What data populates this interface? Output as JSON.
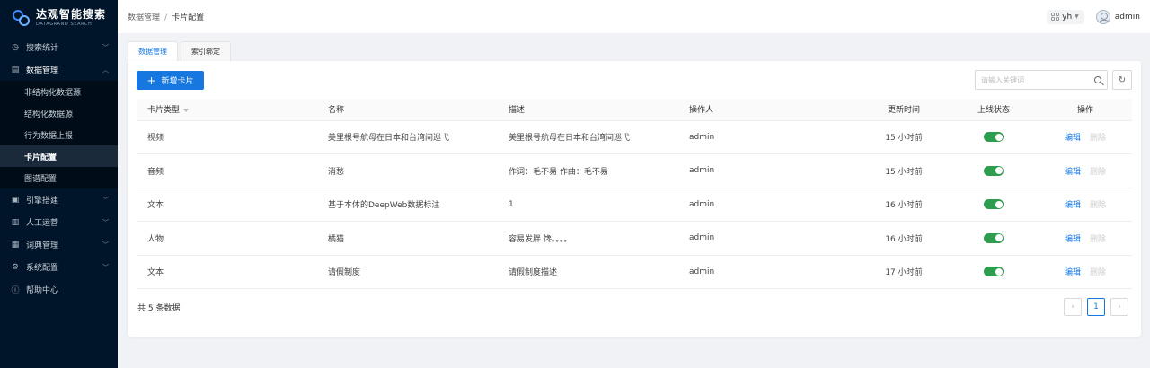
{
  "app": {
    "logo_title": "达观智能搜索",
    "logo_subtitle": "DATAGRAND SEARCH"
  },
  "sidebar": {
    "items": [
      {
        "label": "搜索统计",
        "icon": "clock-icon",
        "chevron": "down"
      },
      {
        "label": "数据管理",
        "icon": "document-icon",
        "chevron": "up",
        "open": true,
        "children": [
          {
            "label": "非结构化数据源"
          },
          {
            "label": "结构化数据源"
          },
          {
            "label": "行为数据上报"
          },
          {
            "label": "卡片配置",
            "active": true
          },
          {
            "label": "图谱配置"
          }
        ]
      },
      {
        "label": "引擎搭建",
        "icon": "engine-icon",
        "chevron": "down"
      },
      {
        "label": "人工运营",
        "icon": "operation-icon",
        "chevron": "down"
      },
      {
        "label": "词典管理",
        "icon": "book-icon",
        "chevron": "down"
      },
      {
        "label": "系统配置",
        "icon": "gear-icon",
        "chevron": "down"
      },
      {
        "label": "帮助中心",
        "icon": "help-icon"
      }
    ]
  },
  "header": {
    "breadcrumb": [
      "数据管理",
      "卡片配置"
    ],
    "breadcrumb_sep": "/",
    "workspace": "yh",
    "user": "admin"
  },
  "tabs": [
    {
      "label": "数据管理",
      "active": true
    },
    {
      "label": "索引绑定",
      "active": false
    }
  ],
  "toolbar": {
    "add_label": "新增卡片",
    "search_placeholder": "请输入关键词"
  },
  "table": {
    "columns": [
      "卡片类型",
      "名称",
      "描述",
      "操作人",
      "更新时间",
      "上线状态",
      "操作"
    ],
    "rows": [
      {
        "type": "视频",
        "name": "美里根号航母在日本和台湾间巡弋",
        "desc": "美里根号航母在日本和台湾间巡弋",
        "operator": "admin",
        "updated": "15 小时前",
        "online": true
      },
      {
        "type": "音频",
        "name": "消愁",
        "desc": "作词：毛不易 作曲：毛不易",
        "operator": "admin",
        "updated": "15 小时前",
        "online": true
      },
      {
        "type": "文本",
        "name": "基于本体的DeepWeb数据标注",
        "desc": "1",
        "operator": "admin",
        "updated": "16 小时前",
        "online": true
      },
      {
        "type": "人物",
        "name": "橘猫",
        "desc": "容易发胖 馋。。。。",
        "operator": "admin",
        "updated": "16 小时前",
        "online": true
      },
      {
        "type": "文本",
        "name": "请假制度",
        "desc": "请假制度描述",
        "operator": "admin",
        "updated": "17 小时前",
        "online": true
      }
    ],
    "edit_label": "编辑",
    "delete_label": "删除"
  },
  "footer": {
    "total": "共 5 条数据",
    "current_page": "1"
  },
  "colors": {
    "sidebar_bg": "#001529",
    "primary": "#1677e0",
    "toggle_on": "#2e9d4f"
  }
}
